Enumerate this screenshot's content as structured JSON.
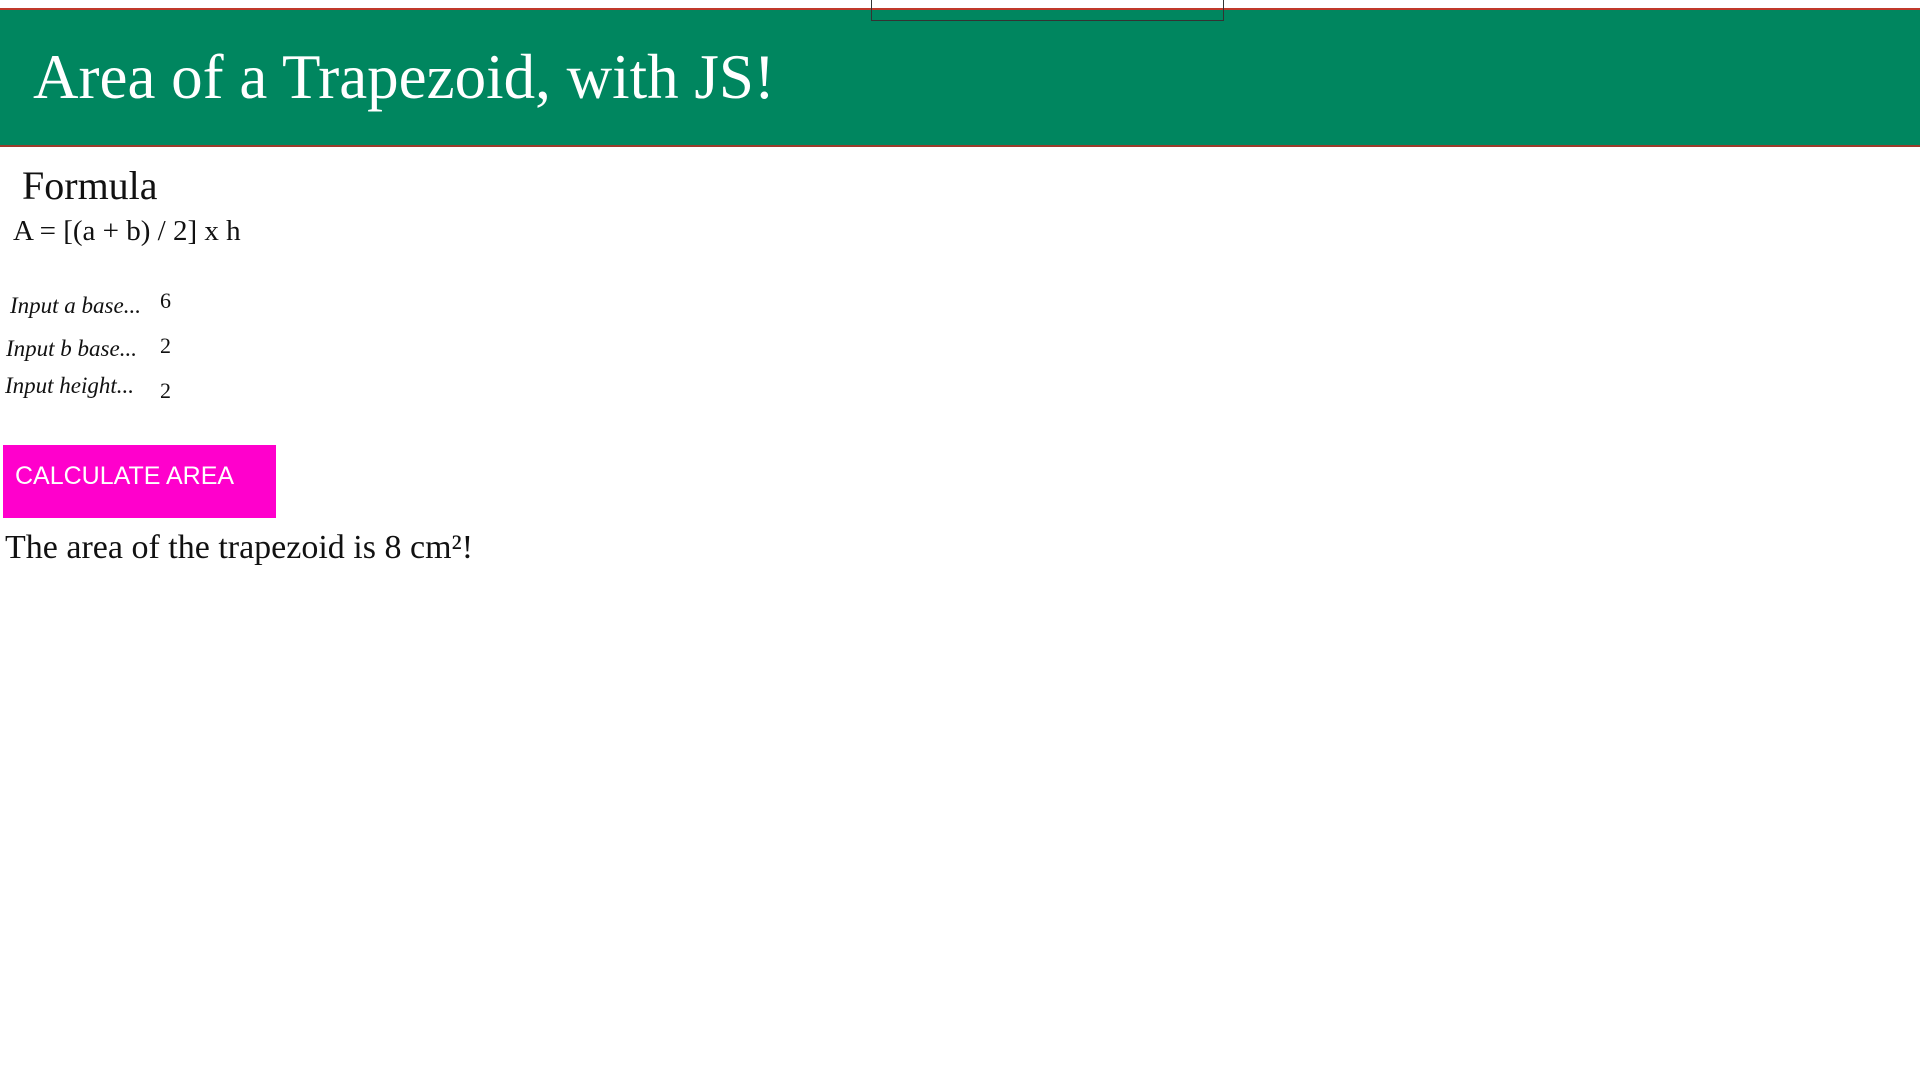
{
  "header": {
    "title": "Area of a Trapezoid, with JS!"
  },
  "formula": {
    "heading": "Formula",
    "expression": "A = [(a + b) / 2] x h"
  },
  "inputs": [
    {
      "label": "Input a base...",
      "value": "6"
    },
    {
      "label": "Input b base...",
      "value": "2"
    },
    {
      "label": "Input height...",
      "value": "2"
    }
  ],
  "button": {
    "label": "CALCULATE AREA"
  },
  "result": {
    "text": "The area of the trapezoid is 8 cm²!"
  },
  "colors": {
    "header_background": "#00865f",
    "button_background": "#ff00cc",
    "header_text": "#ffffff"
  }
}
